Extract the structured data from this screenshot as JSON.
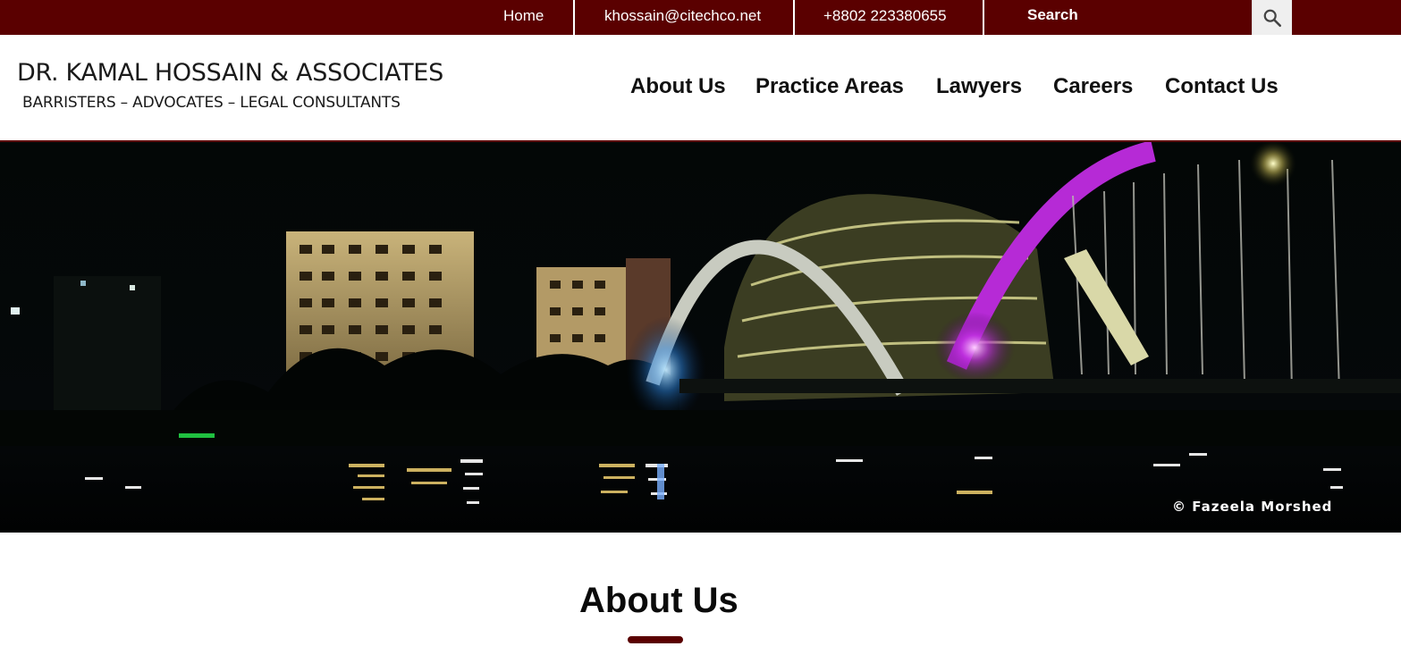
{
  "topbar": {
    "home_label": "Home",
    "email": "khossain@citechco.net",
    "phone": "+8802  223380655",
    "search_placeholder": "Search"
  },
  "logo": {
    "title": "DR. KAMAL HOSSAIN & ASSOCIATES",
    "subtitle": "BARRISTERS – ADVOCATES – LEGAL CONSULTANTS"
  },
  "nav": {
    "items": [
      {
        "label": "About Us"
      },
      {
        "label": "Practice Areas"
      },
      {
        "label": "Lawyers"
      },
      {
        "label": "Careers"
      },
      {
        "label": "Contact Us"
      }
    ]
  },
  "hero": {
    "photo_credit": "© Fazeela Morshed"
  },
  "main": {
    "heading": "About Us"
  },
  "colors": {
    "brand": "#5a0000",
    "accent_purple": "#c030e0"
  }
}
